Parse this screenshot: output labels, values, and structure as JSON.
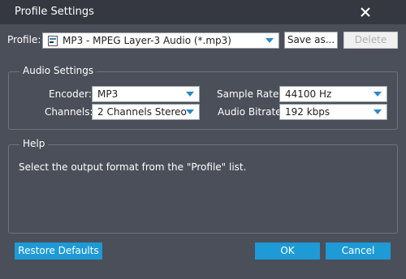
{
  "window": {
    "title": "Profile Settings"
  },
  "profile": {
    "label": "Profile:",
    "value": "MP3 - MPEG Layer-3 Audio (*.mp3)",
    "save_as_label": "Save as...",
    "delete_label": "Delete"
  },
  "audio_settings": {
    "legend": "Audio Settings",
    "encoder_label": "Encoder:",
    "encoder_value": "MP3",
    "channels_label": "Channels:",
    "channels_value": "2 Channels Stereo",
    "sample_rate_label": "Sample Rate:",
    "sample_rate_value": "44100 Hz",
    "audio_bitrate_label": "Audio Bitrate:",
    "audio_bitrate_value": "192 kbps"
  },
  "help": {
    "legend": "Help",
    "text": "Select the output format from the \"Profile\" list."
  },
  "footer": {
    "restore_label": "Restore Defaults",
    "ok_label": "OK",
    "cancel_label": "Cancel"
  },
  "colors": {
    "background": "#4a4f5a",
    "titlebar": "#353840",
    "accent": "#1e9ad7",
    "dropdown_arrow": "#2b89c9"
  },
  "icons": {
    "close": "close-icon",
    "profile_format": "audio-file-icon",
    "dropdown": "chevron-down-icon"
  }
}
